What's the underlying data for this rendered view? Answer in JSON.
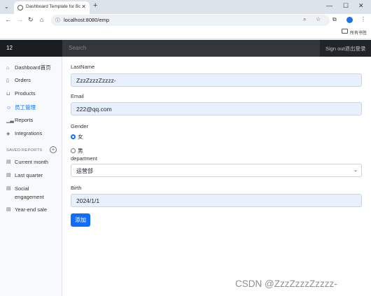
{
  "browser": {
    "tab_title": "Dashboard Template for Boo",
    "url": "localhost:8080/emp",
    "bookmarks_label": "所有书签"
  },
  "navbar": {
    "brand": "12",
    "search_placeholder": "Search",
    "signout": "Sign out退出登录"
  },
  "sidebar": {
    "items": [
      {
        "label": "Dashboard首页",
        "icon": "home-icon"
      },
      {
        "label": "Orders",
        "icon": "file-icon"
      },
      {
        "label": "Products",
        "icon": "cart-icon"
      },
      {
        "label": "员工管理",
        "icon": "users-icon",
        "active": true
      },
      {
        "label": "Reports",
        "icon": "bar-chart-icon"
      },
      {
        "label": "Integrations",
        "icon": "layers-icon"
      }
    ],
    "saved_heading": "SAVED REPORTS",
    "reports": [
      {
        "label": "Current month"
      },
      {
        "label": "Last quarter"
      },
      {
        "label": "Social engagement"
      },
      {
        "label": "Year-end sale"
      }
    ]
  },
  "form": {
    "lastname_label": "LastName",
    "lastname_value": "ZzzZzzzZzzzz-",
    "email_label": "Email",
    "email_value": "222@qq.com",
    "gender_label": "Gender",
    "gender_options": [
      {
        "label": "女",
        "checked": true
      },
      {
        "label": "男",
        "checked": false
      }
    ],
    "department_label": "department",
    "department_value": "运营部",
    "birth_label": "Birth",
    "birth_value": "2024/1/1",
    "submit_label": "添加"
  },
  "watermark": "CSDN @ZzzZzzzZzzzz-",
  "colors": {
    "accent": "#0d6efd",
    "navbar": "#212529",
    "input_autofill": "#e8f0fe"
  }
}
